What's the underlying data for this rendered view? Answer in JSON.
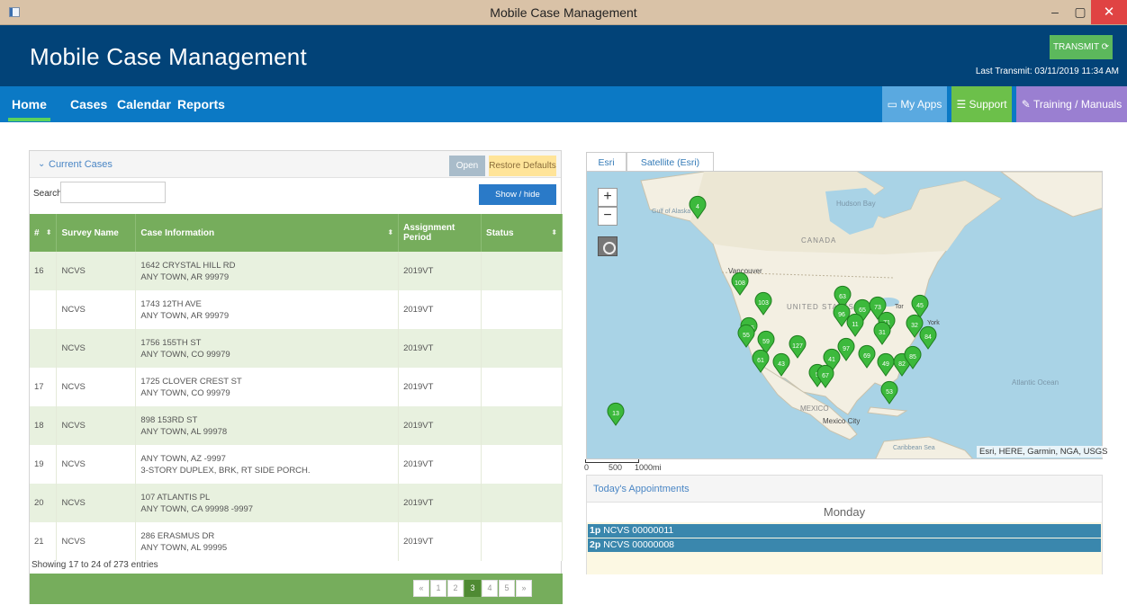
{
  "window": {
    "title": "Mobile Case Management",
    "minimize": "–",
    "maximize": "▢",
    "close": "✕"
  },
  "header": {
    "title": "Mobile Case Management",
    "transmit_label": "TRANSMIT ⟳",
    "last_transmit_label": "Last Transmit:",
    "last_transmit_value": "03/11/2019 11:34 AM"
  },
  "nav": {
    "home": "Home",
    "cases": "Cases",
    "calendar": "Calendar",
    "reports": "Reports",
    "my_apps": "▭ My Apps",
    "support": "☰ Support",
    "training": "✎ Training / Manuals"
  },
  "cases_panel": {
    "title": "Current Cases",
    "chevron": "⌄",
    "open_label": "Open",
    "restore_label": "Restore Defaults",
    "search_label": "Search:",
    "show_hide_label": "Show / hide columns",
    "columns": [
      "#",
      "Survey Name",
      "Case Information",
      "Assignment Period",
      "Status"
    ],
    "rows": [
      {
        "num": "16",
        "survey": "NCVS",
        "line1": "1642 CRYSTAL HILL RD",
        "line2": "ANY TOWN, AR 99979",
        "period": "2019VT",
        "status": ""
      },
      {
        "num": "",
        "survey": "NCVS",
        "line1": "1743 12TH AVE",
        "line2": "ANY TOWN, AR 99979",
        "period": "2019VT",
        "status": ""
      },
      {
        "num": "",
        "survey": "NCVS",
        "line1": "1756 155TH ST",
        "line2": "ANY TOWN, CO 99979",
        "period": "2019VT",
        "status": ""
      },
      {
        "num": "17",
        "survey": "NCVS",
        "line1": "1725 CLOVER CREST ST",
        "line2": "ANY TOWN, CO 99979",
        "period": "2019VT",
        "status": ""
      },
      {
        "num": "18",
        "survey": "NCVS",
        "line1": "898 153RD ST",
        "line2": "ANY TOWN, AL 99978",
        "period": "2019VT",
        "status": ""
      },
      {
        "num": "19",
        "survey": "NCVS",
        "line1": "ANY TOWN, AZ -9997",
        "line2": "3-STORY DUPLEX, BRK, RT SIDE PORCH.",
        "period": "2019VT",
        "status": ""
      },
      {
        "num": "20",
        "survey": "NCVS",
        "line1": "107 ATLANTIS PL",
        "line2": "ANY TOWN, CA 99998 -9997",
        "period": "2019VT",
        "status": ""
      },
      {
        "num": "21",
        "survey": "NCVS",
        "line1": "286 ERASMUS DR",
        "line2": "ANY TOWN, AL 99995",
        "period": "2019VT",
        "status": ""
      }
    ],
    "footer_info": "Showing 17 to 24 of 273 entries",
    "pages": [
      "«",
      "1",
      "2",
      "3",
      "4",
      "5",
      "»"
    ],
    "active_page": "3"
  },
  "map": {
    "tabs": [
      "Esri",
      "Satellite (Esri)"
    ],
    "zoom_in": "+",
    "zoom_out": "−",
    "labels": {
      "hudson_bay": "Hudson Bay",
      "gulf_alaska": "Gulf of Alaska",
      "canada": "CANADA",
      "vancouver": "Vancouver",
      "united_states": "UNITED STATES",
      "mexico": "MEXICO",
      "mexico_city": "Mexico City",
      "caribbean": "Caribbean Sea",
      "atlantic": "Atlantic Ocean",
      "toronto": "Tor",
      "new_york": "York"
    },
    "attribution": "Esri, HERE, Garmin, NGA, USGS",
    "scale": [
      "0",
      "500",
      "1000mi"
    ],
    "markers": [
      "4",
      "108",
      "103",
      "63",
      "96",
      "65",
      "73",
      "45",
      "11",
      "71",
      "32",
      "84",
      "125",
      "55",
      "59",
      "127",
      "97",
      "31",
      "61",
      "43",
      "41",
      "69",
      "49",
      "82",
      "85",
      "5",
      "67",
      "53",
      "13"
    ]
  },
  "appointments": {
    "title": "Today's Appointments",
    "day": "Monday",
    "items": [
      {
        "time": "1p",
        "text": "NCVS 00000011"
      },
      {
        "time": "2p",
        "text": "NCVS 00000008"
      }
    ]
  }
}
